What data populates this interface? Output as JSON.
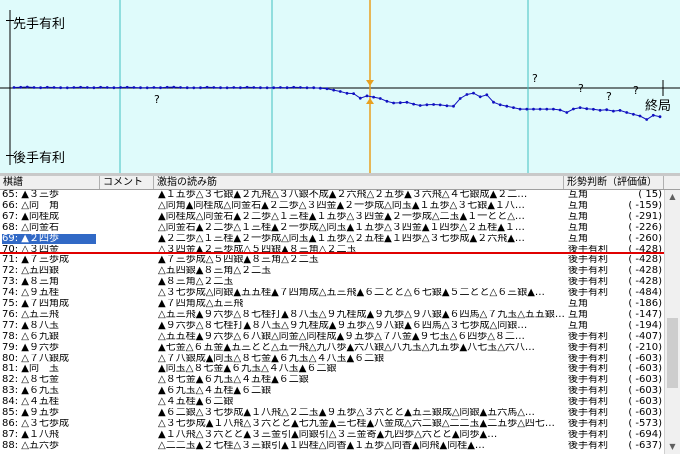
{
  "graph": {
    "label_top": "先手有利",
    "label_bottom": "後手有利",
    "label_end": "終局",
    "question_marks": [
      "?",
      "?",
      "?",
      "?",
      "?"
    ],
    "colors": {
      "background": "#dffbfb",
      "line": "#1010c0",
      "cursor": "#e8a020",
      "grid": "#40c0c0"
    },
    "eval_series": [
      15,
      20,
      30,
      15,
      10,
      20,
      15,
      10,
      5,
      15,
      20,
      15,
      10,
      20,
      15,
      10,
      15,
      20,
      15,
      10,
      5,
      15,
      10,
      20,
      25,
      15,
      10,
      5,
      10,
      20,
      15,
      10,
      5,
      15,
      10,
      20,
      15,
      10,
      5,
      10,
      15,
      10,
      20,
      15,
      5,
      10,
      -5,
      -20,
      -60,
      -100,
      -150,
      -159,
      -291,
      -226,
      -260,
      -300,
      -380,
      -428,
      -420,
      -410,
      -460,
      -500,
      -480,
      -470,
      -484,
      -510,
      -520,
      -300,
      -186,
      -147,
      -250,
      -194,
      -407,
      -480,
      -520,
      -560,
      -603,
      -603,
      -603,
      -603,
      -603,
      -603,
      -630,
      -700,
      -600,
      -560,
      -590,
      -610,
      -637,
      -620,
      -660,
      -640,
      -700,
      -750,
      -800,
      -900,
      -780,
      -820
    ]
  },
  "table": {
    "headers": {
      "move": "棋譜",
      "comment": "コメント",
      "line": "激指の読み筋",
      "judge": "形勢判断（評価値）"
    },
    "rows": [
      {
        "move": "65: ▲３三歩",
        "line": "▲１五歩△３七銀▲２九飛△３八銀不成▲２六飛△２五歩▲３六飛△４七銀成▲２二…",
        "judge": "互角",
        "eval": "(    15)"
      },
      {
        "move": "66: △同　角",
        "line": "△同角▲同桂成△同金右▲２二歩△３四金▲２一歩成△同玉▲１五歩△３七銀▲１八…",
        "judge": "互角",
        "eval": "(  -159)"
      },
      {
        "move": "67: ▲同桂成",
        "line": "▲同桂成△同金右▲２二歩△１三桂▲１五歩△３四金▲２一歩成△二玉▲１一とと△…",
        "judge": "互角",
        "eval": "(  -291)"
      },
      {
        "move": "68: △同金右",
        "line": "△同金右▲２二歩△１三桂▲２一歩成△同玉▲１五歩△３四金▲１四歩△２五桂▲１…",
        "judge": "互角",
        "eval": "(  -226)"
      },
      {
        "move": "69: ▲２四歩",
        "line": "▲２二歩△１三桂▲２一歩成△同玉▲１五歩△２五桂▲１四歩△３七歩成▲２六飛▲…",
        "judge": "互角",
        "eval": "(  -260)",
        "selected": true
      },
      {
        "move": "70: △３四金",
        "line": "△３四金▲２三歩成△５四銀▲８三角△２二玉",
        "judge": "後手有利",
        "eval": "(  -428)"
      },
      {
        "move": "71: ▲７三歩成",
        "line": "▲７三歩成△５四銀▲８三角△２二玉",
        "judge": "後手有利",
        "eval": "(  -428)"
      },
      {
        "move": "72: △五四銀",
        "line": "△五四銀▲８三角△２二玉",
        "judge": "後手有利",
        "eval": "(  -428)"
      },
      {
        "move": "73: ▲８三角",
        "line": "▲８三角△２二玉",
        "judge": "後手有利",
        "eval": "(  -428)"
      },
      {
        "move": "74: △９五桂",
        "line": "△３七歩成△同銀▲五五桂▲７四角成△五三飛▲６二とと△６七銀▲５二とと△６三銀▲…",
        "judge": "後手有利",
        "eval": "(  -484)"
      },
      {
        "move": "75: ▲７四角成",
        "line": "▲７四角成△五三飛",
        "judge": "互角",
        "eval": "(  -186)"
      },
      {
        "move": "76: △五三飛",
        "line": "△五三飛▲９六歩△８七桂打▲８八玉△９九桂成▲９九歩△９八銀▲６四馬△７九玉△五五銀…",
        "judge": "互角",
        "eval": "(  -147)"
      },
      {
        "move": "77: ▲８八玉",
        "line": "▲９六歩△８七桂打▲８八玉△９九桂成▲９五歩△９八銀▲６四馬△３七歩成△同銀…",
        "judge": "互角",
        "eval": "(  -194)"
      },
      {
        "move": "78: △６九銀",
        "line": "△五五桂▲９六歩△６八銀△同金△同桂成▲９五歩△７八金▲９七玉△６四歩△８二…",
        "judge": "後手有利",
        "eval": "(  -407)"
      },
      {
        "move": "79: ▲９六歩",
        "line": "▲七金△６五金▲五三とと△五一飛△九八歩▲六八銀△八九玉△九五歩▲八七玉△六八…",
        "judge": "後手有利",
        "eval": "(  -210)"
      },
      {
        "move": "80: △７八銀成",
        "line": "△７八銀成▲同玉△８七金▲６九玉△４八玉▲６二銀",
        "judge": "後手有利",
        "eval": "(  -603)"
      },
      {
        "move": "81: ▲同　玉",
        "line": "▲同玉△８七金▲６九玉△４八玉▲６二銀",
        "judge": "後手有利",
        "eval": "(  -603)"
      },
      {
        "move": "82: △８七金",
        "line": "△８七金▲６九玉△４五桂▲６二銀",
        "judge": "後手有利",
        "eval": "(  -603)"
      },
      {
        "move": "83: ▲６九玉",
        "line": "▲６九玉△４五桂▲６二銀",
        "judge": "後手有利",
        "eval": "(  -603)"
      },
      {
        "move": "84: △４五桂",
        "line": "△４五桂▲６二銀",
        "judge": "後手有利",
        "eval": "(  -603)"
      },
      {
        "move": "85: ▲９五歩",
        "line": "▲６二銀△３七歩成▲１八飛△２二玉▲９五歩△３六とと▲五三銀成△同銀▲五六馬△…",
        "judge": "後手有利",
        "eval": "(  -603)"
      },
      {
        "move": "86: △３七歩成",
        "line": "△３七歩成▲１八飛△３六とと▲七九金▲三七桂▲八金成△六二銀△二二玉▲二五歩△四七…",
        "judge": "後手有利",
        "eval": "(  -573)"
      },
      {
        "move": "87: ▲１八飛",
        "line": "▲１八飛△３六とと▲３三金引▲同銀引△３三金寄▲九四歩△六とと▲同歩▲…",
        "judge": "後手有利",
        "eval": "(  -694)"
      },
      {
        "move": "88: △五六歩",
        "line": "△二二玉▲２七桂△３三銀引▲１四桂△同香▲１五歩△同香▲同飛▲同桂▲…",
        "judge": "後手有利",
        "eval": "(  -637)"
      }
    ]
  }
}
